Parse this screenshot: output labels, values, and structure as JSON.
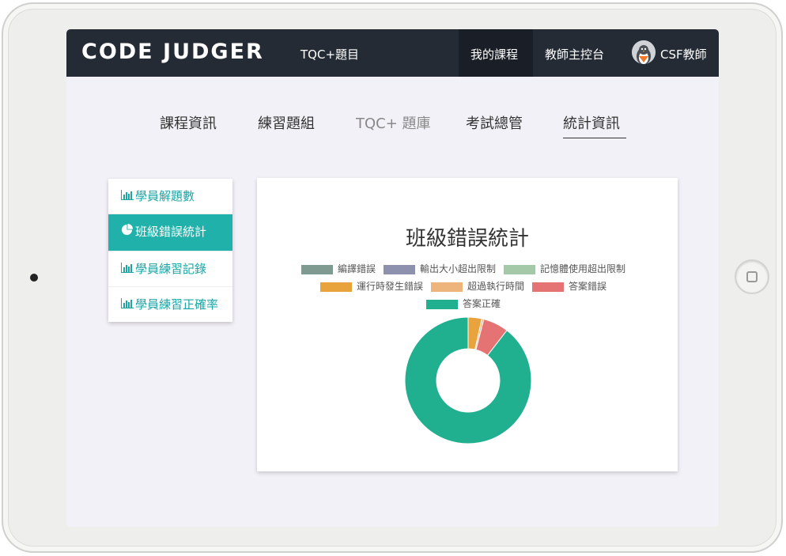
{
  "navbar": {
    "brand": "CODE JUDGER",
    "tqc_link": "TQC+題目",
    "my_courses": "我的課程",
    "teacher_console": "教師主控台",
    "user_name": "CSF教師"
  },
  "tabs": [
    {
      "label": "課程資訊"
    },
    {
      "label": "練習題組"
    },
    {
      "label": "TQC+ 題庫"
    },
    {
      "label": "考試總管"
    },
    {
      "label": "統計資訊",
      "active": true
    }
  ],
  "sidebar": {
    "items": [
      {
        "label": "學員解題數",
        "icon": "bar-chart-icon"
      },
      {
        "label": "班級錯誤統計",
        "icon": "pie-chart-icon",
        "active": true
      },
      {
        "label": "學員練習記錄",
        "icon": "bar-chart-icon"
      },
      {
        "label": "學員練習正確率",
        "icon": "bar-chart-icon"
      }
    ]
  },
  "chart_data": {
    "type": "pie",
    "title": "班級錯誤統計",
    "donut": true,
    "legend_position": "top",
    "labels": [
      "編譯錯誤",
      "輸出大小超出限制",
      "記憶體使用超出限制",
      "運行時發生錯誤",
      "超過執行時間",
      "答案錯誤",
      "答案正確"
    ],
    "values": [
      0,
      0,
      0,
      3.5,
      0.5,
      6.5,
      89.5
    ],
    "colors": [
      "#7f9a90",
      "#8e91ad",
      "#a3c9a8",
      "#e8a33d",
      "#edb47c",
      "#e57373",
      "#20b08f"
    ]
  },
  "colors": {
    "navbar_bg": "#252b35",
    "accent": "#20b2aa",
    "screen_bg": "#f2f1f7"
  }
}
